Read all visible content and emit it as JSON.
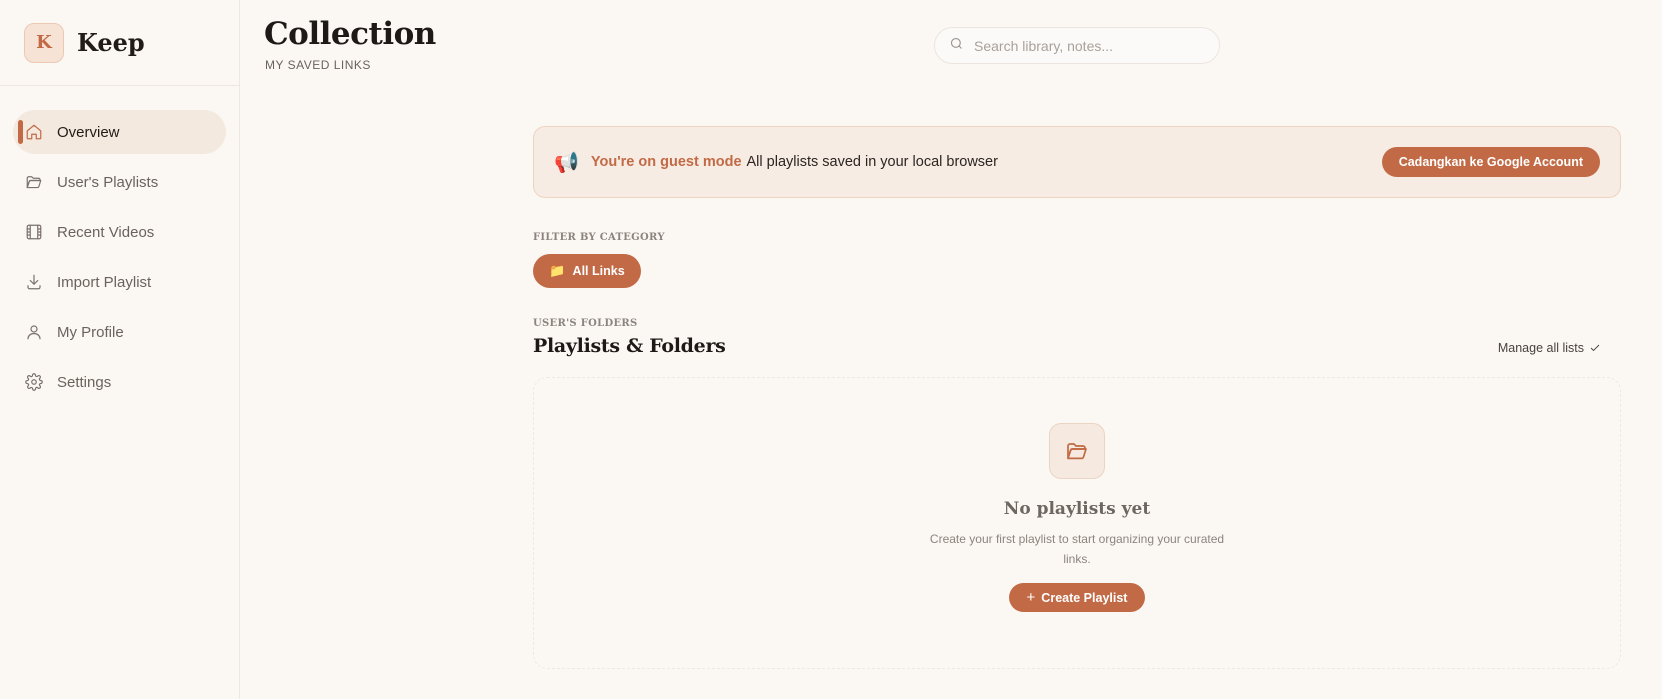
{
  "brand": {
    "logo_letter": "K",
    "name": "Keep"
  },
  "sidebar": {
    "items": [
      {
        "label": "Overview",
        "icon": "home-icon",
        "active": true
      },
      {
        "label": "User's Playlists",
        "icon": "folder-open-icon",
        "active": false
      },
      {
        "label": "Recent Videos",
        "icon": "film-icon",
        "active": false
      },
      {
        "label": "Import Playlist",
        "icon": "download-icon",
        "active": false
      },
      {
        "label": "My Profile",
        "icon": "user-icon",
        "active": false
      },
      {
        "label": "Settings",
        "icon": "gear-icon",
        "active": false
      }
    ]
  },
  "header": {
    "title": "Collection",
    "subtitle": "MY SAVED LINKS",
    "search_placeholder": "Search library, notes..."
  },
  "banner": {
    "icon": "megaphone-icon",
    "strong": "You're on guest mode",
    "text": "All playlists saved in your local browser",
    "button_label": "Cadangkan ke Google Account"
  },
  "filter": {
    "label": "FILTER BY CATEGORY",
    "chip_label": "All Links",
    "chip_icon": "folder-icon"
  },
  "folders": {
    "label": "USER'S FOLDERS",
    "title": "Playlists & Folders",
    "manage_label": "Manage all lists"
  },
  "empty_state": {
    "title": "No playlists yet",
    "description": "Create your first playlist to start organizing your curated links.",
    "button_label": "Create Playlist"
  },
  "colors": {
    "accent": "#c26a45",
    "background": "#fbf8f4",
    "banner_bg": "#f7ece3"
  }
}
